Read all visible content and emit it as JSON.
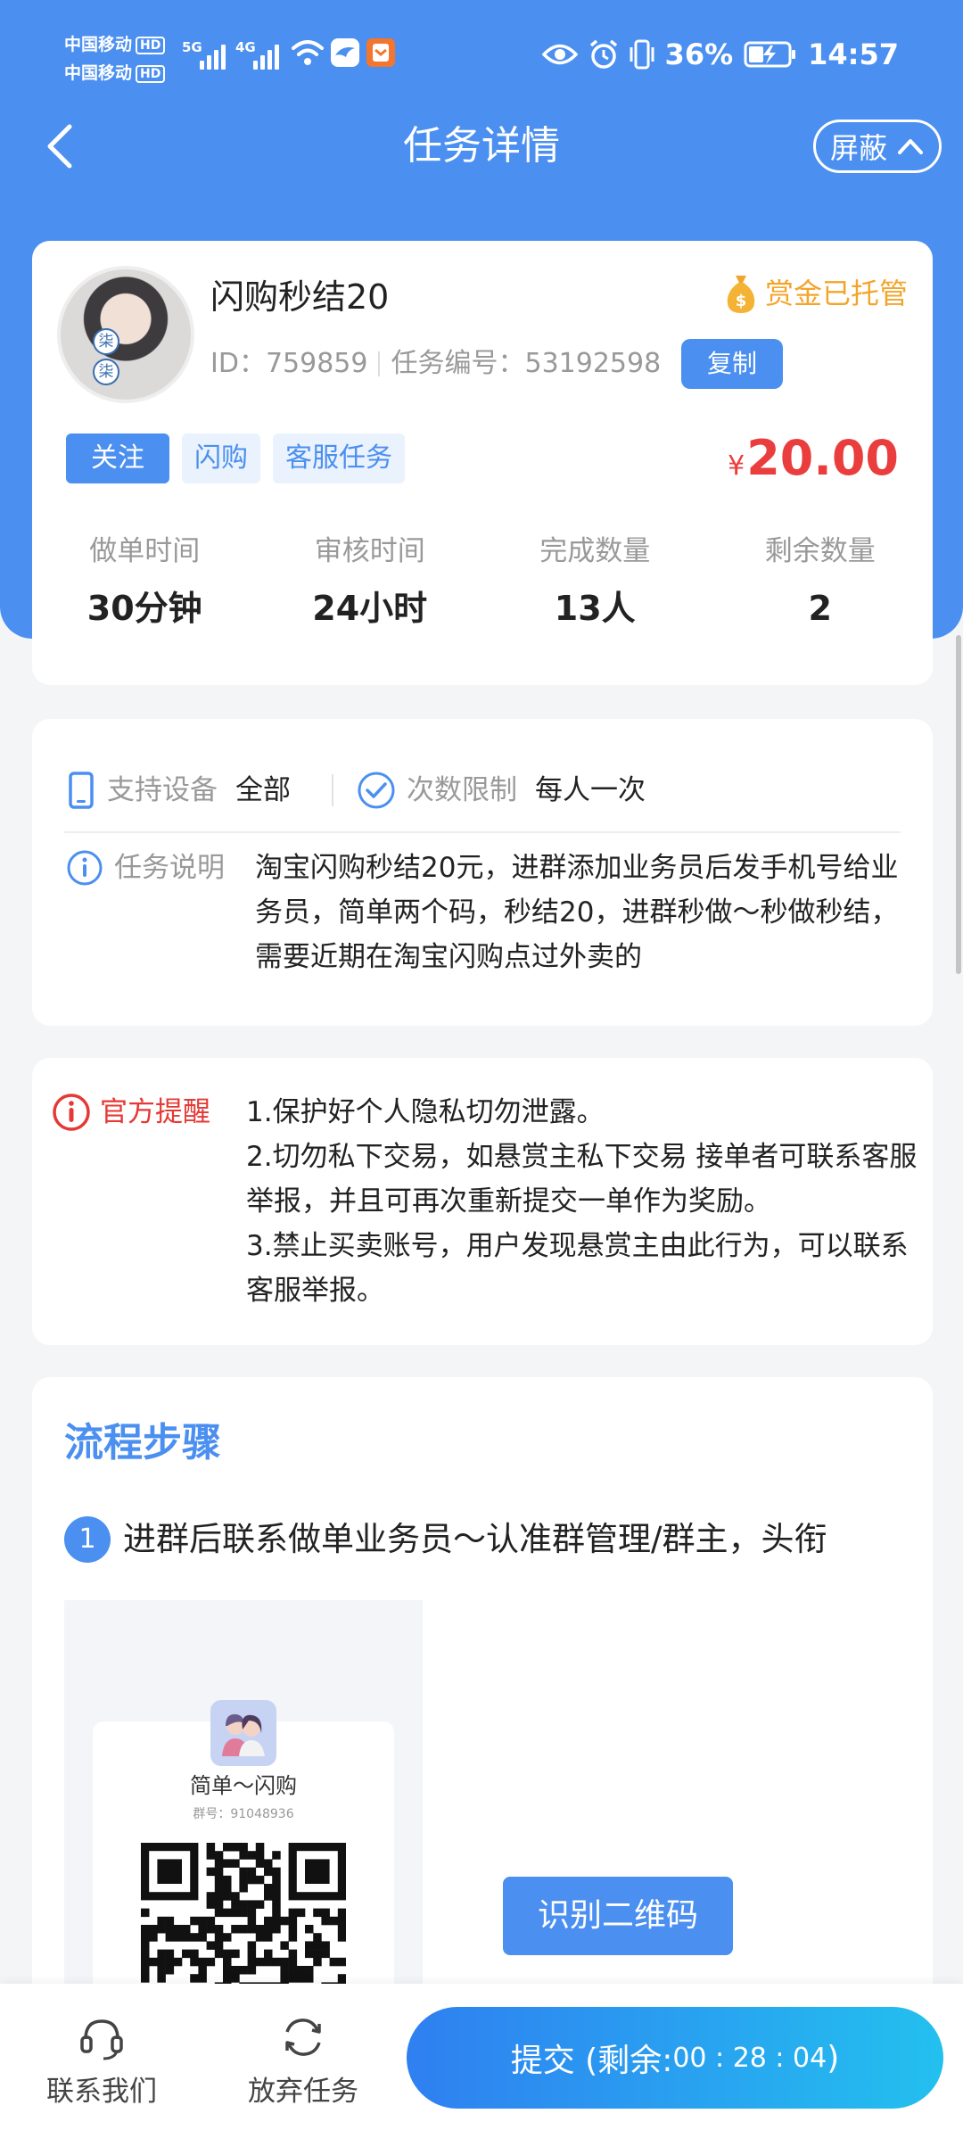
{
  "status_bar": {
    "carrier1": "中国移动",
    "carrier2": "中国移动",
    "hd": "HD",
    "net1": "5G",
    "net2": "4G",
    "battery": "36%",
    "time": "14:57"
  },
  "nav": {
    "title": "任务详情",
    "shield_label": "屏蔽"
  },
  "task": {
    "name": "闪购秒结20",
    "bounty_status": "赏金已托管",
    "id_text": "ID：759859",
    "task_no_text": "任务编号：53192598",
    "copy_label": "复制",
    "avatar_badge_1": "柒",
    "avatar_badge_2": "柒",
    "tags": [
      "关注",
      "闪购",
      "客服任务"
    ],
    "price_symbol": "¥",
    "price": "20.00",
    "stats": [
      {
        "label": "做单时间",
        "value": "30分钟"
      },
      {
        "label": "审核时间",
        "value": "24小时"
      },
      {
        "label": "完成数量",
        "value": "13人"
      },
      {
        "label": "剩余数量",
        "value": "2"
      }
    ]
  },
  "info": {
    "device_label": "支持设备",
    "device_value": "全部",
    "limit_label": "次数限制",
    "limit_value": "每人一次",
    "desc_label": "任务说明",
    "desc_text": "淘宝闪购秒结20元，进群添加业务员后发手机号给业务员，简单两个码，秒结20，进群秒做～秒做秒结，需要近期在淘宝闪购点过外卖的"
  },
  "notice": {
    "label": "官方提醒",
    "lines": [
      "1.保护好个人隐私切勿泄露。",
      "2.切勿私下交易，如悬赏主私下交易 接单者可联系客服举报，并且可再次重新提交一单作为奖励。",
      "3.禁止买卖账号，用户发现悬赏主由此行为，可以联系客服举报。"
    ]
  },
  "steps": {
    "title": "流程步骤",
    "step1_no": "1",
    "step1_text": "进群后联系做单业务员～认准群管理/群主，头衔",
    "group_name": "简单～闪购",
    "group_id": "群号：91048936",
    "recognize_label": "识别二维码"
  },
  "bottom": {
    "contact_label": "联系我们",
    "abandon_label": "放弃任务",
    "submit_label": "提交 (剩余:",
    "timer": "00 : 28 : 04",
    "submit_suffix": ")"
  },
  "colors": {
    "primary": "#4b8ff0",
    "price": "#ea3d3d",
    "bounty": "#f3a52b",
    "notice": "#e53935"
  }
}
